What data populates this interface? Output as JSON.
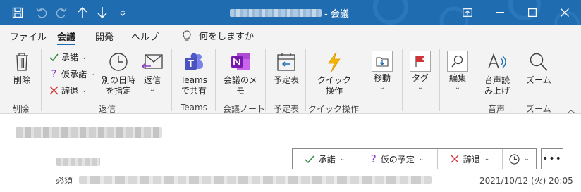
{
  "window": {
    "title_suffix": "- 会議"
  },
  "quick_access": [
    "save-icon",
    "undo-icon",
    "redo-icon",
    "up-arrow-icon",
    "down-arrow-icon",
    "customize-icon"
  ],
  "menu": {
    "tabs": [
      {
        "label": "ファイル"
      },
      {
        "label": "会議",
        "active": true
      },
      {
        "label": "開発"
      },
      {
        "label": "ヘルプ"
      }
    ],
    "tellme": "何をしますか"
  },
  "ribbon": {
    "delete_group": {
      "delete_label": "削除",
      "group_label": "削除"
    },
    "respond_group": {
      "accept_label": "承諾",
      "tentative_label": "仮承諾",
      "decline_label": "辞退",
      "propose_line1": "別の日時",
      "propose_line2": "を指定",
      "reply_label": "返信",
      "group_label": "返信"
    },
    "teams_group": {
      "line1": "Teams",
      "line2": "で共有",
      "group_label": "Teams"
    },
    "onenote_group": {
      "label": "会議のメモ",
      "group_label": "会議ノート"
    },
    "calendar_group": {
      "label": "予定表",
      "group_label": "予定表"
    },
    "quick_group": {
      "line1": "クイック",
      "line2": "操作",
      "group_label": "クイック操作"
    },
    "move_label": "移動",
    "tags_label": "タグ",
    "edit_label": "編集",
    "speech_group": {
      "line1": "音声読",
      "line2": "み上げ",
      "group_label": "音声"
    },
    "zoom_group": {
      "label": "ズーム",
      "group_label": "ズーム"
    }
  },
  "message": {
    "required_label": "必須",
    "datetime": "2021/10/12 (火) 20:05",
    "response": {
      "accept": "承諾",
      "tentative": "仮の予定",
      "decline": "辞退"
    },
    "more": "•••"
  },
  "colors": {
    "titlebar": "#1f6cb0",
    "accent_green": "#2e8b3d",
    "accent_purple": "#8b3fc2",
    "accent_red": "#d13438"
  }
}
